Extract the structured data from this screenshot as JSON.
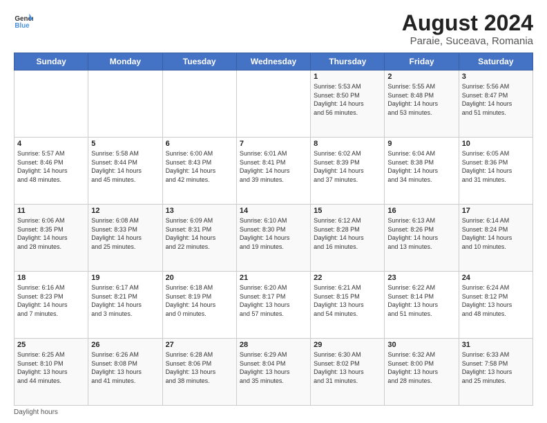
{
  "header": {
    "logo_line1": "General",
    "logo_line2": "Blue",
    "main_title": "August 2024",
    "subtitle": "Paraie, Suceava, Romania"
  },
  "days_of_week": [
    "Sunday",
    "Monday",
    "Tuesday",
    "Wednesday",
    "Thursday",
    "Friday",
    "Saturday"
  ],
  "weeks": [
    [
      {
        "day": "",
        "info": ""
      },
      {
        "day": "",
        "info": ""
      },
      {
        "day": "",
        "info": ""
      },
      {
        "day": "",
        "info": ""
      },
      {
        "day": "1",
        "info": "Sunrise: 5:53 AM\nSunset: 8:50 PM\nDaylight: 14 hours\nand 56 minutes."
      },
      {
        "day": "2",
        "info": "Sunrise: 5:55 AM\nSunset: 8:48 PM\nDaylight: 14 hours\nand 53 minutes."
      },
      {
        "day": "3",
        "info": "Sunrise: 5:56 AM\nSunset: 8:47 PM\nDaylight: 14 hours\nand 51 minutes."
      }
    ],
    [
      {
        "day": "4",
        "info": "Sunrise: 5:57 AM\nSunset: 8:46 PM\nDaylight: 14 hours\nand 48 minutes."
      },
      {
        "day": "5",
        "info": "Sunrise: 5:58 AM\nSunset: 8:44 PM\nDaylight: 14 hours\nand 45 minutes."
      },
      {
        "day": "6",
        "info": "Sunrise: 6:00 AM\nSunset: 8:43 PM\nDaylight: 14 hours\nand 42 minutes."
      },
      {
        "day": "7",
        "info": "Sunrise: 6:01 AM\nSunset: 8:41 PM\nDaylight: 14 hours\nand 39 minutes."
      },
      {
        "day": "8",
        "info": "Sunrise: 6:02 AM\nSunset: 8:39 PM\nDaylight: 14 hours\nand 37 minutes."
      },
      {
        "day": "9",
        "info": "Sunrise: 6:04 AM\nSunset: 8:38 PM\nDaylight: 14 hours\nand 34 minutes."
      },
      {
        "day": "10",
        "info": "Sunrise: 6:05 AM\nSunset: 8:36 PM\nDaylight: 14 hours\nand 31 minutes."
      }
    ],
    [
      {
        "day": "11",
        "info": "Sunrise: 6:06 AM\nSunset: 8:35 PM\nDaylight: 14 hours\nand 28 minutes."
      },
      {
        "day": "12",
        "info": "Sunrise: 6:08 AM\nSunset: 8:33 PM\nDaylight: 14 hours\nand 25 minutes."
      },
      {
        "day": "13",
        "info": "Sunrise: 6:09 AM\nSunset: 8:31 PM\nDaylight: 14 hours\nand 22 minutes."
      },
      {
        "day": "14",
        "info": "Sunrise: 6:10 AM\nSunset: 8:30 PM\nDaylight: 14 hours\nand 19 minutes."
      },
      {
        "day": "15",
        "info": "Sunrise: 6:12 AM\nSunset: 8:28 PM\nDaylight: 14 hours\nand 16 minutes."
      },
      {
        "day": "16",
        "info": "Sunrise: 6:13 AM\nSunset: 8:26 PM\nDaylight: 14 hours\nand 13 minutes."
      },
      {
        "day": "17",
        "info": "Sunrise: 6:14 AM\nSunset: 8:24 PM\nDaylight: 14 hours\nand 10 minutes."
      }
    ],
    [
      {
        "day": "18",
        "info": "Sunrise: 6:16 AM\nSunset: 8:23 PM\nDaylight: 14 hours\nand 7 minutes."
      },
      {
        "day": "19",
        "info": "Sunrise: 6:17 AM\nSunset: 8:21 PM\nDaylight: 14 hours\nand 3 minutes."
      },
      {
        "day": "20",
        "info": "Sunrise: 6:18 AM\nSunset: 8:19 PM\nDaylight: 14 hours\nand 0 minutes."
      },
      {
        "day": "21",
        "info": "Sunrise: 6:20 AM\nSunset: 8:17 PM\nDaylight: 13 hours\nand 57 minutes."
      },
      {
        "day": "22",
        "info": "Sunrise: 6:21 AM\nSunset: 8:15 PM\nDaylight: 13 hours\nand 54 minutes."
      },
      {
        "day": "23",
        "info": "Sunrise: 6:22 AM\nSunset: 8:14 PM\nDaylight: 13 hours\nand 51 minutes."
      },
      {
        "day": "24",
        "info": "Sunrise: 6:24 AM\nSunset: 8:12 PM\nDaylight: 13 hours\nand 48 minutes."
      }
    ],
    [
      {
        "day": "25",
        "info": "Sunrise: 6:25 AM\nSunset: 8:10 PM\nDaylight: 13 hours\nand 44 minutes."
      },
      {
        "day": "26",
        "info": "Sunrise: 6:26 AM\nSunset: 8:08 PM\nDaylight: 13 hours\nand 41 minutes."
      },
      {
        "day": "27",
        "info": "Sunrise: 6:28 AM\nSunset: 8:06 PM\nDaylight: 13 hours\nand 38 minutes."
      },
      {
        "day": "28",
        "info": "Sunrise: 6:29 AM\nSunset: 8:04 PM\nDaylight: 13 hours\nand 35 minutes."
      },
      {
        "day": "29",
        "info": "Sunrise: 6:30 AM\nSunset: 8:02 PM\nDaylight: 13 hours\nand 31 minutes."
      },
      {
        "day": "30",
        "info": "Sunrise: 6:32 AM\nSunset: 8:00 PM\nDaylight: 13 hours\nand 28 minutes."
      },
      {
        "day": "31",
        "info": "Sunrise: 6:33 AM\nSunset: 7:58 PM\nDaylight: 13 hours\nand 25 minutes."
      }
    ]
  ],
  "footer": {
    "note": "Daylight hours"
  }
}
